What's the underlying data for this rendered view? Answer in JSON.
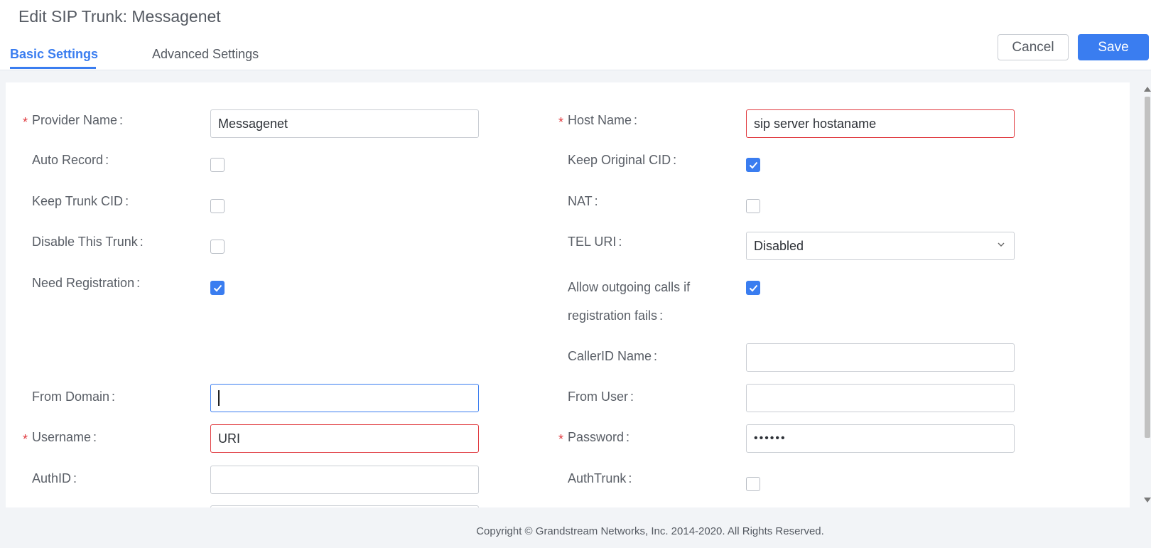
{
  "header": {
    "title": "Edit SIP Trunk: Messagenet",
    "tabs": [
      {
        "label": "Basic Settings",
        "active": true
      },
      {
        "label": "Advanced Settings",
        "active": false
      }
    ],
    "cancel_label": "Cancel",
    "save_label": "Save"
  },
  "form": {
    "required_mark": "*",
    "colon": ":",
    "left": {
      "provider_name": {
        "label": "Provider Name",
        "value": "Messagenet",
        "required": true
      },
      "auto_record": {
        "label": "Auto Record",
        "checked": false
      },
      "keep_trunk_cid": {
        "label": "Keep Trunk CID",
        "checked": false
      },
      "disable_trunk": {
        "label": "Disable This Trunk",
        "checked": false
      },
      "need_registration": {
        "label": "Need Registration",
        "checked": true
      },
      "from_domain": {
        "label": "From Domain",
        "value": ""
      },
      "username": {
        "label": "Username",
        "value": "URI",
        "required": true
      },
      "authid": {
        "label": "AuthID",
        "value": ""
      }
    },
    "right": {
      "host_name": {
        "label": "Host Name",
        "value": "sip server hostaname",
        "required": true
      },
      "keep_original_cid": {
        "label": "Keep Original CID",
        "checked": true
      },
      "nat": {
        "label": "NAT",
        "checked": false
      },
      "tel_uri": {
        "label": "TEL URI",
        "value": "Disabled"
      },
      "allow_outgoing": {
        "label": "Allow outgoing calls if registration fails",
        "checked": true
      },
      "callerid_name": {
        "label": "CallerID Name",
        "value": ""
      },
      "from_user": {
        "label": "From User",
        "value": ""
      },
      "password": {
        "label": "Password",
        "value": "••••••",
        "required": true
      },
      "authtrunk": {
        "label": "AuthTrunk",
        "checked": false
      }
    }
  },
  "footer": {
    "copyright": "Copyright © Grandstream Networks, Inc. 2014-2020. All Rights Reserved."
  },
  "colors": {
    "accent": "#3a7df0",
    "error": "#e0393e",
    "background": "#f2f4f7"
  }
}
